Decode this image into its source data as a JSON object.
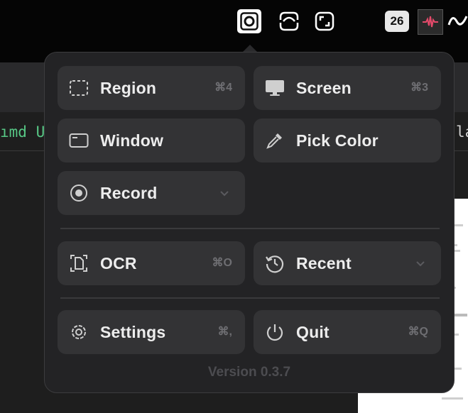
{
  "background": {
    "code_left": "ımd U",
    "code_right": "la"
  },
  "menubar": {
    "calendar_day": "26"
  },
  "menu": {
    "region": {
      "label": "Region",
      "shortcut": "⌘4"
    },
    "screen": {
      "label": "Screen",
      "shortcut": "⌘3"
    },
    "window": {
      "label": "Window"
    },
    "pick_color": {
      "label": "Pick Color"
    },
    "record": {
      "label": "Record"
    },
    "ocr": {
      "label": "OCR",
      "shortcut": "⌘O"
    },
    "recent": {
      "label": "Recent"
    },
    "settings": {
      "label": "Settings",
      "shortcut": "⌘,"
    },
    "quit": {
      "label": "Quit",
      "shortcut": "⌘Q"
    },
    "version": "Version 0.3.7"
  },
  "colors": {
    "panel": "#232325",
    "button": "#333335",
    "text": "#ededed",
    "shortcut": "#6e6e72",
    "code_green": "#57c785"
  },
  "icons": {
    "region": "dashed-rect-icon",
    "screen": "monitor-icon",
    "window": "window-icon",
    "pick_color": "eyedropper-icon",
    "record": "record-icon",
    "ocr": "ocr-document-icon",
    "recent": "history-clock-icon",
    "settings": "gear-icon",
    "quit": "power-icon"
  }
}
